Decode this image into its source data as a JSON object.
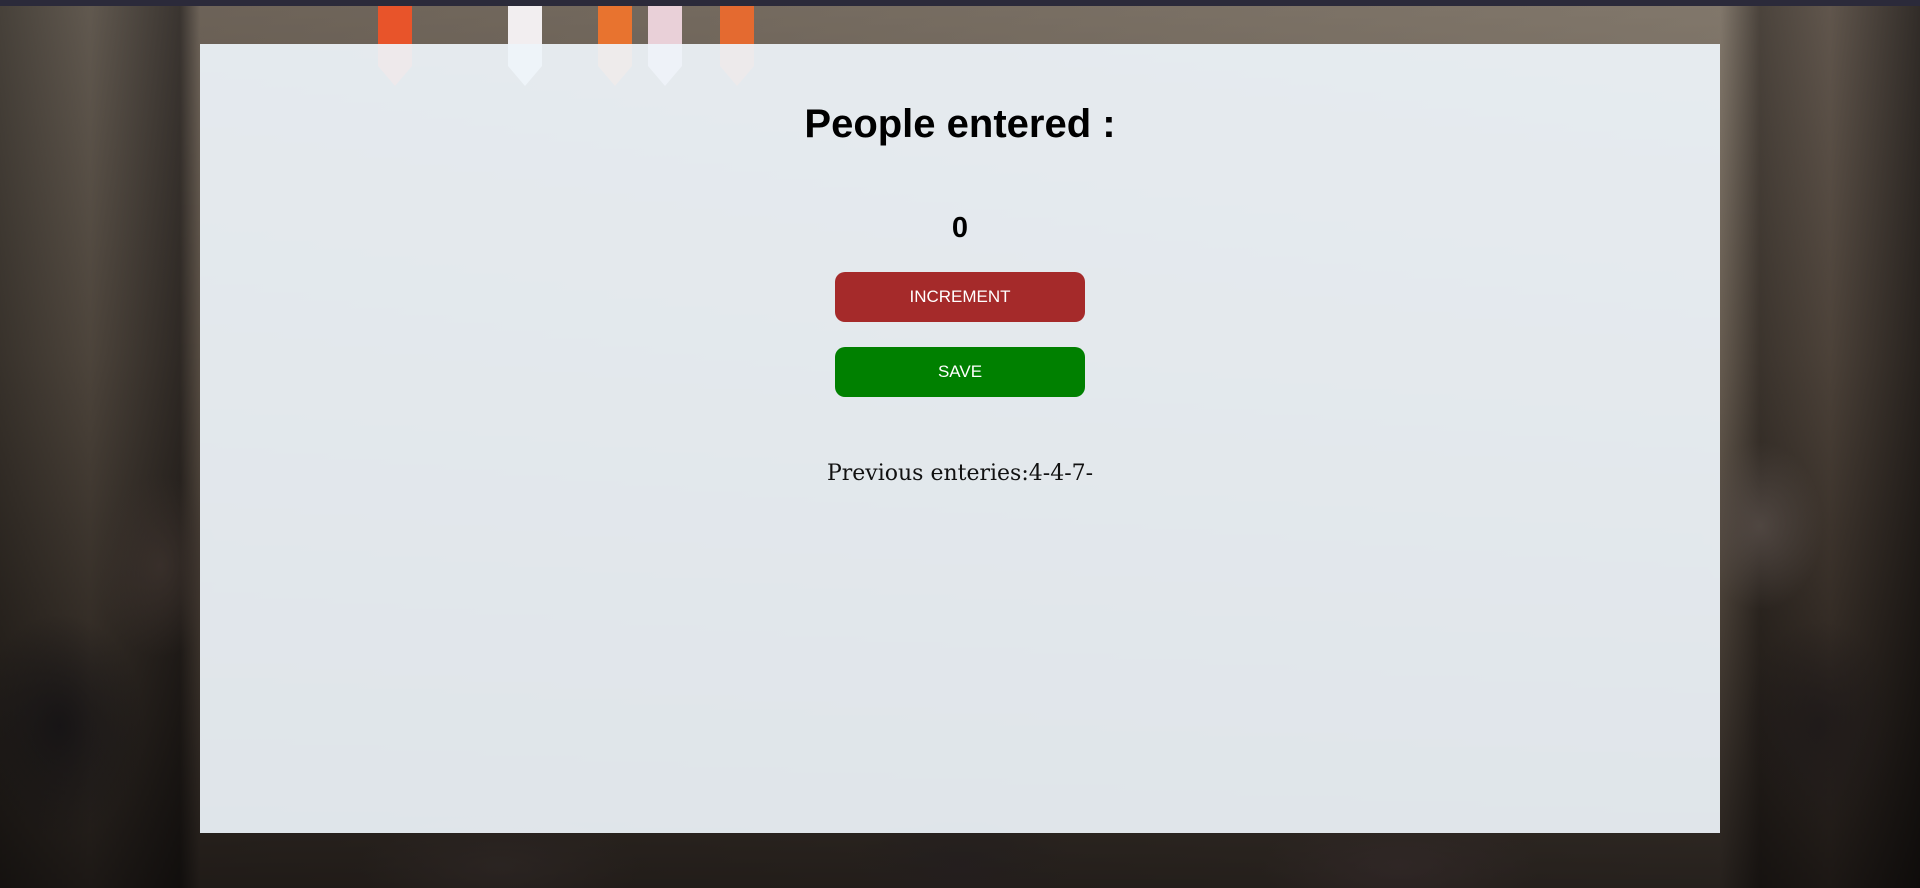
{
  "counter": {
    "title": "People entered :",
    "value": "0",
    "increment_label": "INCREMENT",
    "save_label": "SAVE",
    "previous_entries": "Previous enteries:4-4-7-"
  },
  "colors": {
    "increment_button": "#a52a2a",
    "save_button": "#008000",
    "panel_background": "#eef4fa"
  }
}
